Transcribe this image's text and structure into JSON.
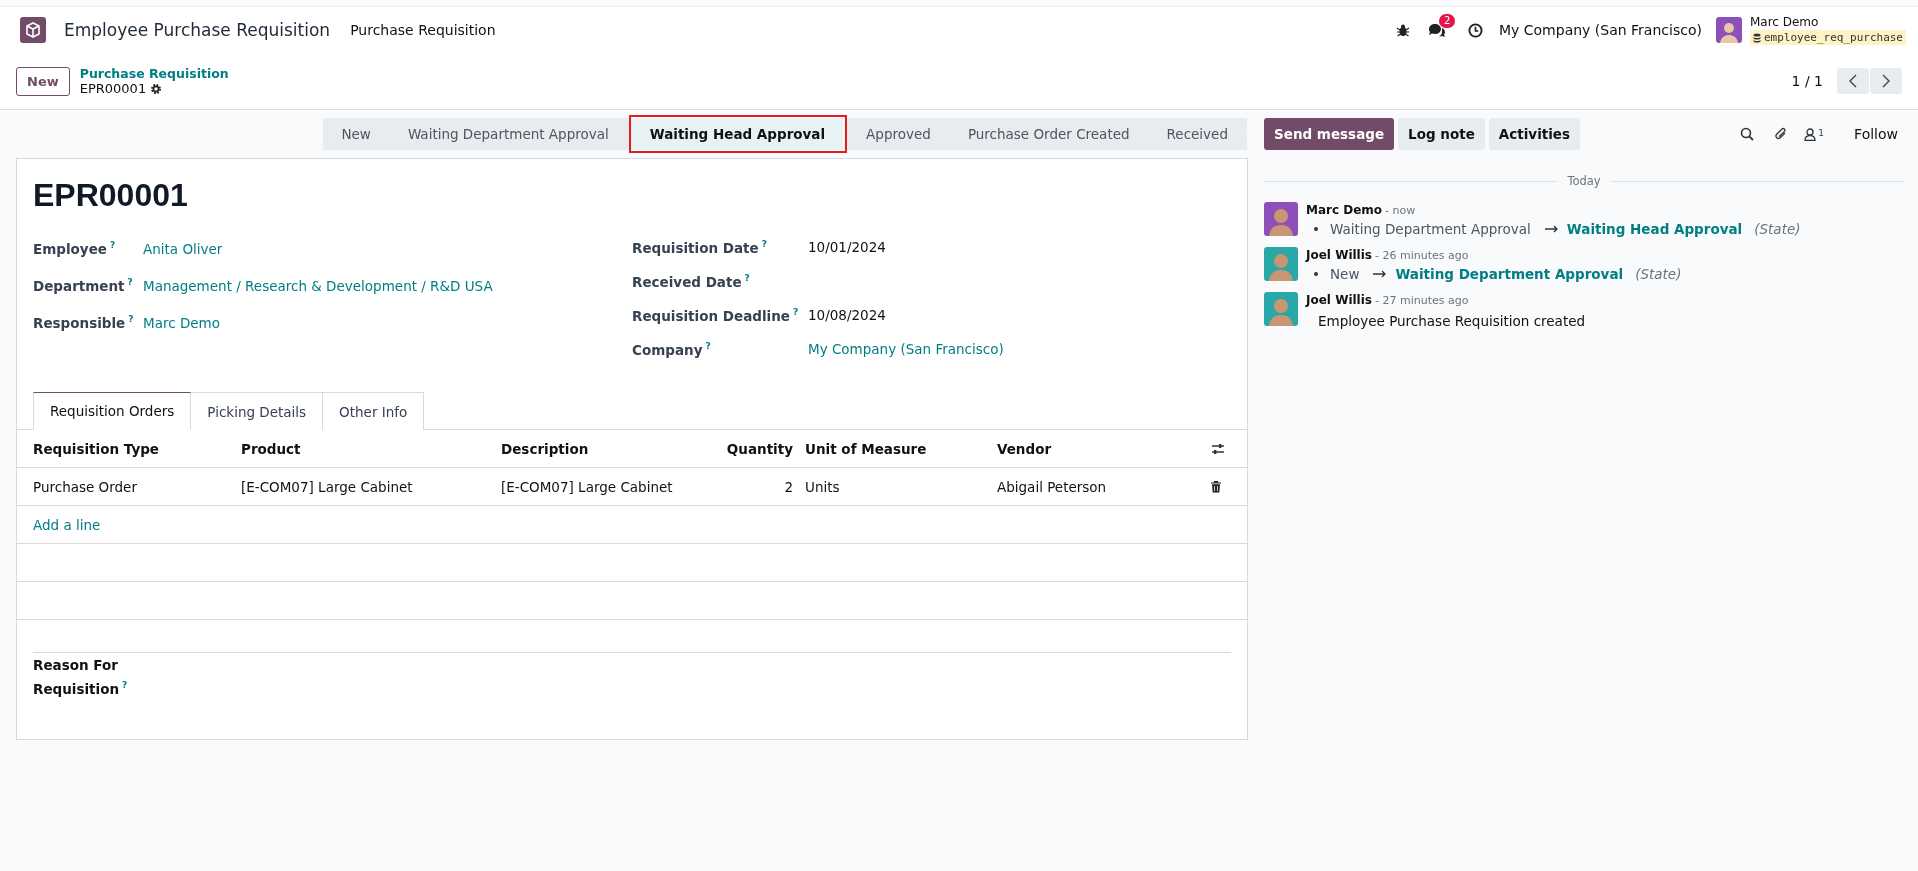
{
  "navbar": {
    "app_name": "Employee Purchase Requisition",
    "menu": [
      "Purchase Requisition"
    ],
    "chat_badge": "2",
    "company": "My Company (San Francisco)",
    "user": {
      "name": "Marc Demo",
      "database": "employee_req_purchase"
    }
  },
  "control_panel": {
    "new_button": "New",
    "breadcrumb": "Purchase Requisition",
    "record": "EPR00001",
    "pager": "1 / 1"
  },
  "statusbar": [
    {
      "label": "New",
      "selected": false
    },
    {
      "label": "Waiting Department Approval",
      "selected": false
    },
    {
      "label": "Waiting Head Approval",
      "selected": true
    },
    {
      "label": "Approved",
      "selected": false
    },
    {
      "label": "Purchase Order Created",
      "selected": false
    },
    {
      "label": "Received",
      "selected": false
    }
  ],
  "form": {
    "title": "EPR00001",
    "left_fields": [
      {
        "label": "Employee",
        "help": "?",
        "value": "Anita Oliver",
        "link": true
      },
      {
        "label": "Department",
        "help": "?",
        "value": "Management / Research & Development / R&D USA",
        "link": true
      },
      {
        "label": "Responsible",
        "help": "?",
        "value": "Marc Demo",
        "link": true
      }
    ],
    "right_fields": [
      {
        "label": "Requisition Date",
        "help": "?",
        "value": "10/01/2024",
        "link": false
      },
      {
        "label": "Received Date",
        "help": "?"
      },
      {
        "label": "Requisition Deadline",
        "help": "?",
        "value": "10/08/2024",
        "link": false
      },
      {
        "label": "Company",
        "help": "?",
        "value": "My Company (San Francisco)",
        "link": true
      }
    ],
    "tabs": [
      {
        "label": "Requisition Orders",
        "selected": true
      },
      {
        "label": "Picking Details",
        "selected": false
      },
      {
        "label": "Other Info",
        "selected": false
      }
    ],
    "table": {
      "columns": [
        {
          "label": "Requisition Type"
        },
        {
          "label": "Product"
        },
        {
          "label": "Description"
        },
        {
          "label": "Quantity"
        },
        {
          "label": "Unit of Measure"
        },
        {
          "label": "Vendor"
        }
      ],
      "rows": [
        [
          "Purchase Order",
          "[E-COM07] Large Cabinet",
          "[E-COM07] Large Cabinet",
          "2",
          "Units",
          "Abigail Peterson"
        ]
      ],
      "add_line": "Add a line"
    },
    "reason": {
      "label": "Reason For Requisition",
      "help": "?"
    }
  },
  "chatter": {
    "buttons": [
      {
        "label": "Send message",
        "primary": true
      },
      {
        "label": "Log note",
        "primary": false
      },
      {
        "label": "Activities",
        "primary": false
      }
    ],
    "followers": "1",
    "follow": "Follow",
    "date_separator": "Today",
    "messages": [
      {
        "author": "Marc Demo",
        "time": "- now",
        "kind": "tracking",
        "color": "#8e4fb8",
        "old": "Waiting Department Approval",
        "new": "Waiting Head Approval",
        "field": "(State)"
      },
      {
        "author": "Joel Willis",
        "time": "- 26 minutes ago",
        "kind": "tracking",
        "color": "#2aa7a7",
        "old": "New",
        "new": "Waiting Department Approval",
        "field": "(State)"
      },
      {
        "author": "Joel Willis",
        "time": "- 27 minutes ago",
        "kind": "text",
        "color": "#2aa7a7",
        "body": "Employee Purchase Requisition created"
      }
    ]
  }
}
